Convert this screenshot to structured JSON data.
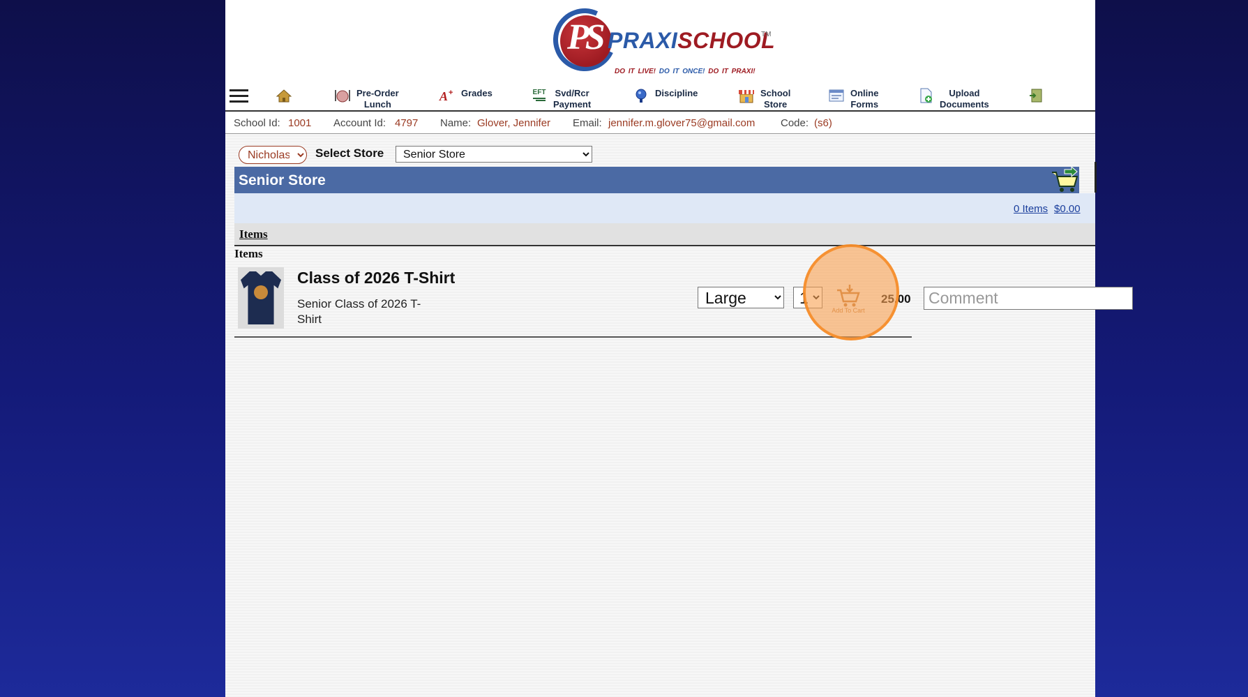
{
  "brand": {
    "ps_letters": "PS",
    "name_first": "PRAXI",
    "name_second": "SCHOOL",
    "tm": "TM",
    "tagline_1": "DO IT LIVE!",
    "tagline_2": "DO IT ONCE!",
    "tagline_3": "DO IT PRAXI!"
  },
  "nav": {
    "items": [
      {
        "label": "",
        "icon": "home-icon"
      },
      {
        "label": "Pre-Order\nLunch",
        "icon": "lunch-icon"
      },
      {
        "label": "Grades",
        "icon": "grades-icon"
      },
      {
        "label": "Svd/Rcr\nPayment",
        "icon": "eft-icon"
      },
      {
        "label": "Discipline",
        "icon": "discipline-icon"
      },
      {
        "label": "School\nStore",
        "icon": "store-icon"
      },
      {
        "label": "Online\nForms",
        "icon": "forms-icon"
      },
      {
        "label": "Upload\nDocuments",
        "icon": "upload-icon"
      },
      {
        "label": "",
        "icon": "logout-icon"
      }
    ],
    "eft_text": "EFT"
  },
  "account": {
    "school_id_label": "School Id:",
    "school_id": "1001",
    "account_id_label": "Account Id:",
    "account_id": "4797",
    "name_label": "Name:",
    "name": "Glover, Jennifer",
    "email_label": "Email:",
    "email": "jennifer.m.glover75@gmail.com",
    "code_label": "Code:",
    "code": "(s6)"
  },
  "store": {
    "student": "Nicholas",
    "select_label": "Select Store",
    "selected_store": "Senior Store",
    "title": "Senior Store",
    "cart_items": "0 Items",
    "cart_total": "$0.00",
    "tab_label": "Items",
    "section_heading": "Items"
  },
  "item": {
    "title": "Class of 2026 T-Shirt",
    "description": "Senior Class of 2026 T-Shirt",
    "size": "Large",
    "quantity": "1",
    "add_to_cart_label": "Add To Cart",
    "price": "25.00",
    "comment_placeholder": "Comment"
  },
  "colors": {
    "header_bar": "#4b6aa4",
    "summary_bg": "#dfe8f6",
    "accent_red": "#9a3a22",
    "highlight": "#f8a050"
  }
}
